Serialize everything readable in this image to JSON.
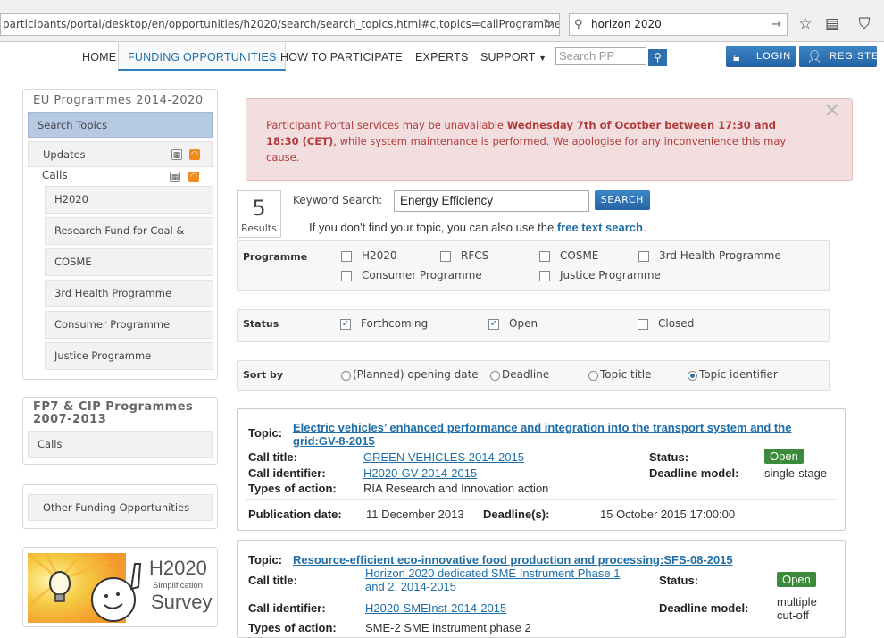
{
  "browser": {
    "url": "participants/portal/desktop/en/opportunities/h2020/search/search_topics.html#c,topics=callProgramme/t/I",
    "search_query": "horizon 2020",
    "icons": [
      "star-icon",
      "reading-list-icon",
      "pocket-icon"
    ]
  },
  "nav": {
    "items": [
      "HOME",
      "FUNDING OPPORTUNITIES",
      "HOW TO PARTICIPATE",
      "EXPERTS",
      "SUPPORT"
    ],
    "search_placeholder": "Search PP",
    "login": "LOGIN",
    "register": "REGISTER"
  },
  "sidebar": {
    "eu_title": "EU Programmes 2014-2020",
    "search_topics": "Search Topics",
    "updates": "Updates",
    "calls": "Calls",
    "call_items": [
      "H2020",
      "Research Fund for Coal & Steel",
      "COSME",
      "3rd Health Programme",
      "Consumer Programme",
      "Justice Programme"
    ],
    "fp7_title": "FP7 & CIP Programmes 2007-2013",
    "fp7_calls": "Calls",
    "other": "Other Funding Opportunities",
    "survey": {
      "title": "H2020",
      "sub": "Simplification",
      "word": "Survey"
    }
  },
  "alert": {
    "pre": "Participant Portal services may be unavailable ",
    "bold": "Wednesday 7th of Ocotber between 17:30 and 18:30 (CET)",
    "post": ", while system maintenance is performed. We apologise for any inconvenience this may cause."
  },
  "search": {
    "results_count": "5",
    "results_label": "Results",
    "keyword_label": "Keyword Search:",
    "keyword_value": "Energy Efficiency",
    "button": "SEARCH",
    "hint_pre": "If you don't find your topic, you can also use the ",
    "hint_link": "free text search",
    "hint_post": "."
  },
  "filters": {
    "programme_label": "Programme",
    "programmes": [
      {
        "label": "H2020",
        "checked": false
      },
      {
        "label": "RFCS",
        "checked": false
      },
      {
        "label": "COSME",
        "checked": false
      },
      {
        "label": "3rd Health Programme",
        "checked": false
      },
      {
        "label": "Consumer Programme",
        "checked": false
      },
      {
        "label": "Justice Programme",
        "checked": false
      }
    ],
    "status_label": "Status",
    "statuses": [
      {
        "label": "Forthcoming",
        "checked": true
      },
      {
        "label": "Open",
        "checked": true
      },
      {
        "label": "Closed",
        "checked": false
      }
    ],
    "sort_label": "Sort by",
    "sorts": [
      {
        "label": "(Planned) opening date",
        "selected": false
      },
      {
        "label": "Deadline",
        "selected": false
      },
      {
        "label": "Topic title",
        "selected": false
      },
      {
        "label": "Topic identifier",
        "selected": true
      }
    ]
  },
  "labels": {
    "topic": "Topic:",
    "call_title": "Call title:",
    "call_identifier": "Call identifier:",
    "types": "Types of action:",
    "status": "Status:",
    "deadline_model": "Deadline model:",
    "publication_date": "Publication date:",
    "deadlines": "Deadline(s):"
  },
  "topics": [
    {
      "title_line1": "Electric vehicles’ enhanced performance and integration into the transport system and the",
      "title_line2": "grid:GV-8-2015",
      "call_title": "GREEN VEHICLES 2014-2015",
      "call_identifier": "H2020-GV-2014-2015",
      "types": "RIA Research and Innovation action",
      "status": "Open",
      "deadline_model": "single-stage",
      "publication_date": "11 December 2013",
      "deadline": "15 October 2015 17:00:00"
    },
    {
      "title_line1": "Resource-efficient eco-innovative food production and processing:SFS-08-2015",
      "call_title_line1": "Horizon 2020 dedicated SME Instrument Phase 1",
      "call_title_line2": "and 2, 2014-2015",
      "call_identifier": "H2020-SMEInst-2014-2015",
      "types": "SME-2 SME instrument phase 2",
      "status": "Open",
      "deadline_model_line1": "multiple",
      "deadline_model_line2": "cut-off"
    }
  ]
}
